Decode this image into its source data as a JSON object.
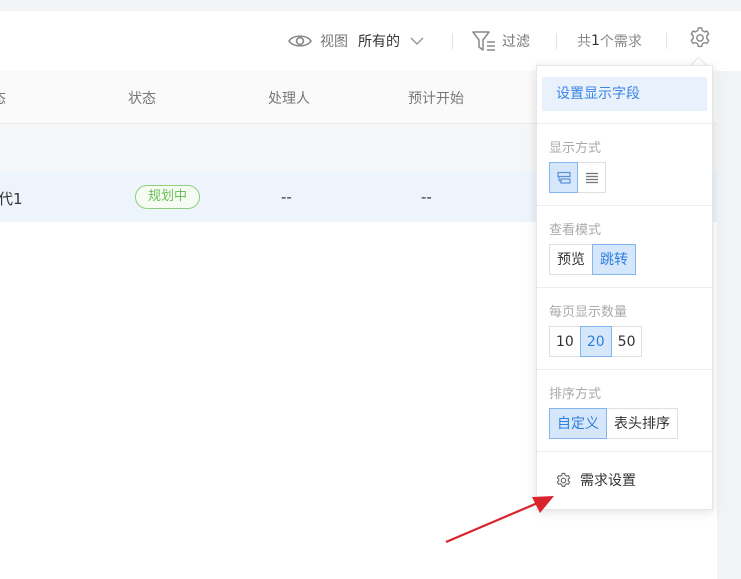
{
  "toolbar": {
    "view_label": "视图",
    "view_value": "所有的",
    "filter_label": "过滤",
    "count_prefix": "共",
    "count_value": "1",
    "count_suffix": "个需求"
  },
  "table": {
    "columns": [
      "态",
      "状态",
      "处理人",
      "预计开始"
    ],
    "rows": [
      {
        "title_partial": "代1",
        "status": "规划中",
        "assignee": "--",
        "start": "--"
      }
    ]
  },
  "settings_popover": {
    "display_fields": "设置显示字段",
    "display_mode_label": "显示方式",
    "view_mode_label": "查看模式",
    "view_mode_options": [
      "预览",
      "跳转"
    ],
    "view_mode_selected": "跳转",
    "page_size_label": "每页显示数量",
    "page_size_options": [
      "10",
      "20",
      "50"
    ],
    "page_size_selected": "20",
    "sort_label": "排序方式",
    "sort_options": [
      "自定义",
      "表头排序"
    ],
    "sort_selected": "自定义",
    "requirement_settings": "需求设置"
  },
  "colors": {
    "accent": "#3b86e6",
    "status_green": "#6bbd5a",
    "annotation_arrow": "#d9232d"
  }
}
